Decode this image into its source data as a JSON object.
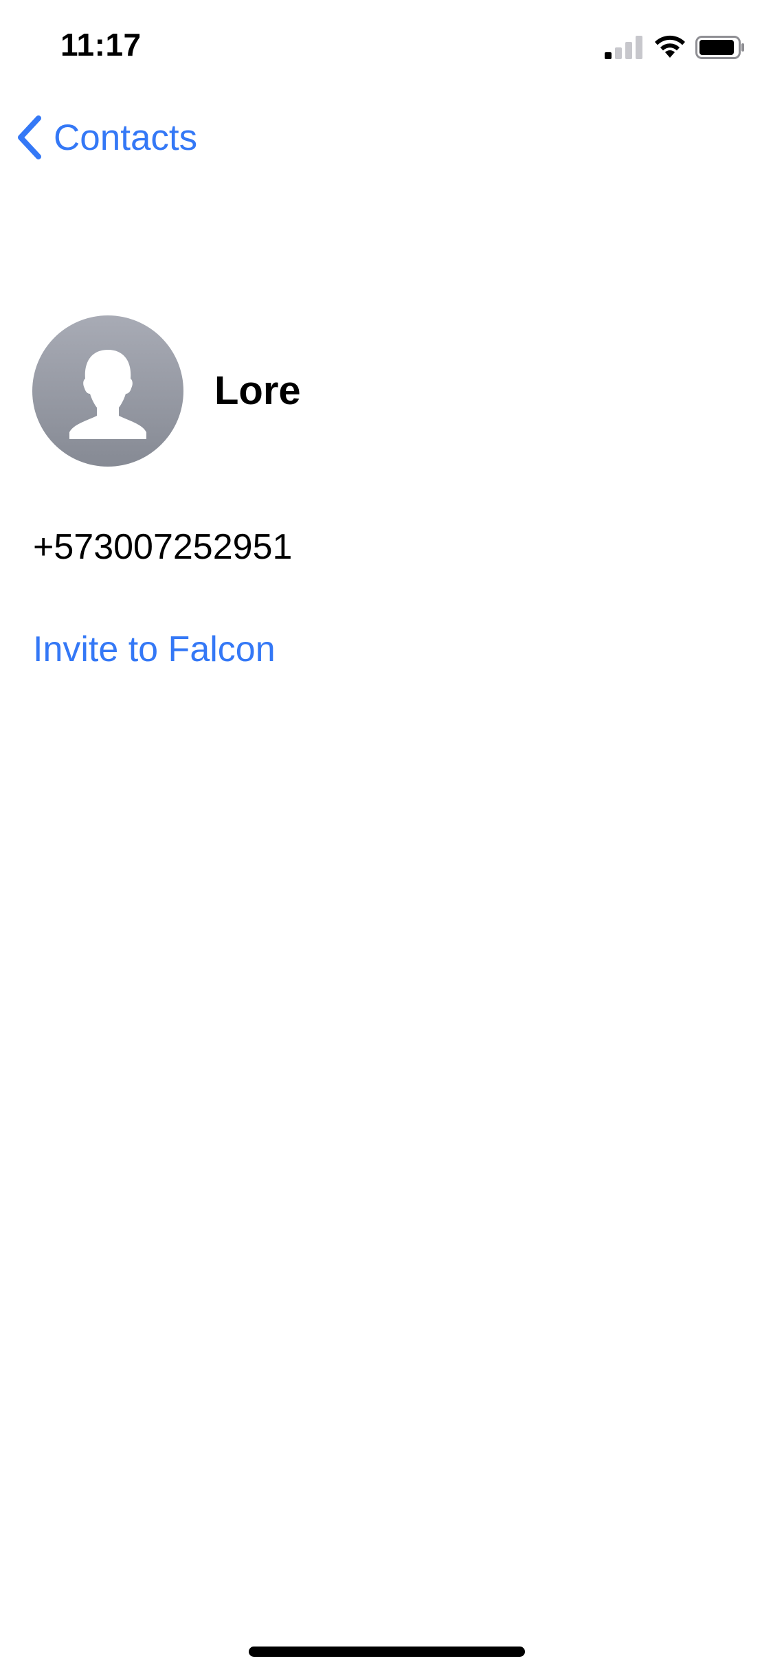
{
  "colors": {
    "accent": "#3478f6",
    "avatar_gradient_top": "#a8abb5",
    "avatar_gradient_bottom": "#868a94"
  },
  "status_bar": {
    "time": "11:17",
    "icons": [
      "signal-icon",
      "wifi-icon",
      "battery-icon"
    ]
  },
  "nav": {
    "back_label": "Contacts",
    "back_icon": "chevron-left-icon"
  },
  "contact": {
    "name": "Lore",
    "avatar_icon": "person-silhouette-icon",
    "phone": "+573007252951"
  },
  "actions": {
    "invite_label": "Invite to Falcon"
  }
}
